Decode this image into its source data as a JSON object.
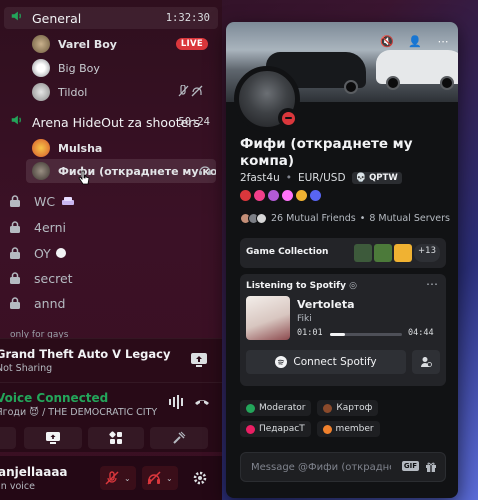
{
  "channels": {
    "voice1": {
      "name": "General",
      "timer": "1:32:30"
    },
    "voice1_members": [
      {
        "name": "Varel Boy",
        "badge": "LIVE"
      },
      {
        "name": "Big Boy"
      },
      {
        "name": "Tildol"
      }
    ],
    "voice2": {
      "name": "Arena HideOut za shooters",
      "timer": "50:24"
    },
    "voice2_members": [
      {
        "name": "Mulsha"
      },
      {
        "name": "Фифи (откраднете му компа)"
      }
    ],
    "text": [
      "WC",
      "4erni",
      "OY",
      "secret",
      "annd"
    ],
    "category": "only for gays"
  },
  "activity": {
    "title": "Grand Theft Auto V Legacy",
    "subtitle": "Not Sharing"
  },
  "voice_status": {
    "status": "Voice Connected",
    "location": "Ягоди 😈 / THE DEMOCRATIC CITY"
  },
  "user": {
    "name": "anjellaaaa",
    "status": "In voice"
  },
  "profile": {
    "display_name": "Фифи (откраднете му компа)",
    "username": "2fast4u",
    "pronouns": "EUR/USD",
    "guild_tag": "QPTW",
    "mutual_friends": "26 Mutual Friends",
    "mutual_servers": "8 Mutual Servers",
    "game_collection_title": "Game Collection",
    "game_more": "+13",
    "spotify": {
      "header": "Listening to Spotify",
      "song": "Vertoleta",
      "artist": "Fiki",
      "elapsed": "01:01",
      "duration": "04:44",
      "progress": 0.21,
      "button": "Connect Spotify"
    },
    "roles": [
      {
        "name": "Moderator",
        "color": "#23a55a"
      },
      {
        "name": "Картоф",
        "color": "#8b4a2b"
      },
      {
        "name": "ПедарасТ",
        "color": "#e91e63"
      },
      {
        "name": "member",
        "color": "#f0812d"
      }
    ],
    "message_placeholder": "Message @Фифи (откраднете му компа)",
    "gif_label": "GIF"
  },
  "colors": {
    "accent_green": "#23a55a",
    "live_red": "#da373c",
    "dnd_red": "#da373c"
  }
}
